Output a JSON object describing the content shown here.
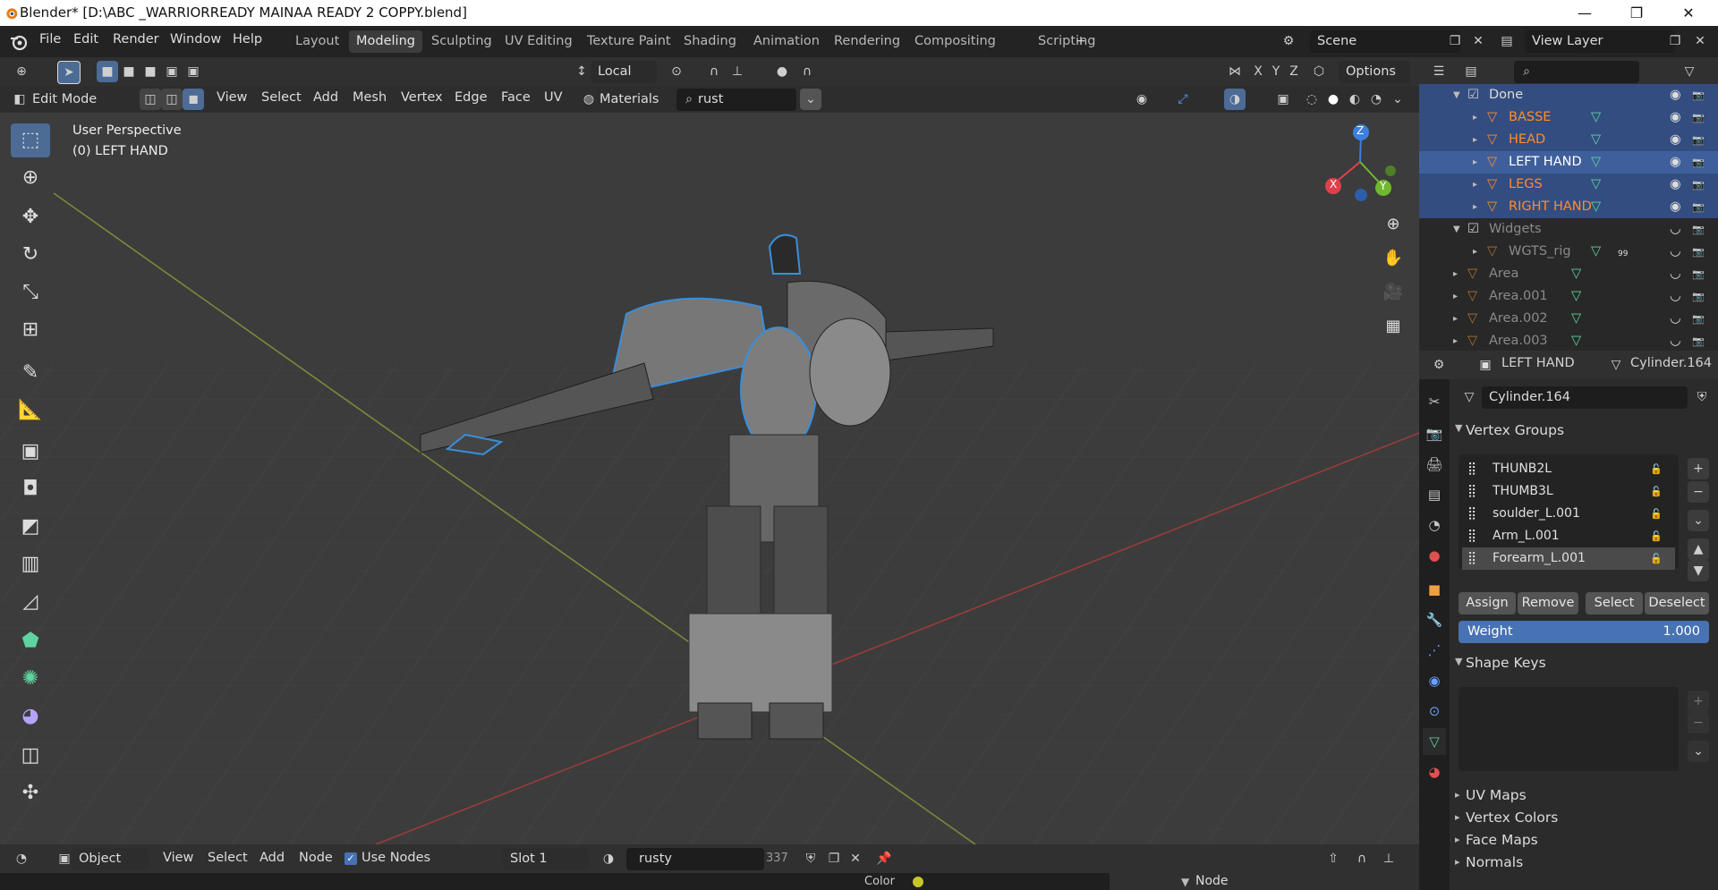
{
  "titlebar": {
    "title": "Blender* [D:\\ABC _WARRIORREADY MAINAA READY 2  COPPY.blend]",
    "minimize": "—",
    "maximize": "❐",
    "close": "✕"
  },
  "menus": [
    "File",
    "Edit",
    "Render",
    "Window",
    "Help"
  ],
  "workspaces": [
    "Layout",
    "Modeling",
    "Sculpting",
    "UV Editing",
    "Texture Paint",
    "Shading",
    "Animation",
    "Rendering",
    "Compositing",
    "Scripting"
  ],
  "active_workspace": "Modeling",
  "scene": {
    "label": "Scene"
  },
  "view_layer": {
    "label": "View Layer"
  },
  "tool_header": {
    "orientation": "Local",
    "options": "Options",
    "x": "X",
    "y": "Y",
    "z": "Z"
  },
  "viewport_header": {
    "mode": "Edit Mode",
    "menus": [
      "View",
      "Select",
      "Add",
      "Mesh",
      "Vertex",
      "Edge",
      "Face",
      "UV"
    ],
    "materials": "Materials",
    "search_value": "rust"
  },
  "viewport": {
    "perspective": "User Perspective",
    "object_label": "(0) LEFT HAND",
    "gizmo": {
      "x": "X",
      "y": "Y",
      "z": "Z"
    }
  },
  "outliner": {
    "rows": [
      {
        "name": "Done",
        "indent": 0,
        "collection": true,
        "selected": true
      },
      {
        "name": "BASSE",
        "indent": 1,
        "selected": true,
        "orange": true
      },
      {
        "name": "HEAD",
        "indent": 1,
        "selected": true,
        "orange": true
      },
      {
        "name": "LEFT HAND",
        "indent": 1,
        "selected": true,
        "active": true
      },
      {
        "name": "LEGS",
        "indent": 1,
        "selected": true,
        "orange": true
      },
      {
        "name": "RIGHT HAND",
        "indent": 1,
        "selected": true,
        "orange": true
      },
      {
        "name": "Widgets",
        "indent": 0,
        "collection": true,
        "dim": true
      },
      {
        "name": "WGTS_rig",
        "indent": 1,
        "dim": true,
        "badge": "99"
      },
      {
        "name": "Area",
        "indent": 0,
        "dim": true
      },
      {
        "name": "Area.001",
        "indent": 0,
        "dim": true
      },
      {
        "name": "Area.002",
        "indent": 0,
        "dim": true
      },
      {
        "name": "Area.003",
        "indent": 0,
        "dim": true
      }
    ]
  },
  "properties": {
    "object_name": "LEFT HAND",
    "mesh_name": "Cylinder.164",
    "data_field": "Cylinder.164",
    "vertex_groups_title": "Vertex Groups",
    "vertex_groups": [
      "THUNB2L",
      "THUMB3L",
      "soulder_L.001",
      "Arm_L.001",
      "Forearm_L.001"
    ],
    "active_group": "Forearm_L.001",
    "buttons": {
      "assign": "Assign",
      "remove": "Remove",
      "select": "Select",
      "deselect": "Deselect"
    },
    "weight": {
      "label": "Weight",
      "value": "1.000"
    },
    "shape_keys_title": "Shape Keys",
    "collapsed_panels": [
      "UV Maps",
      "Vertex Colors",
      "Face Maps",
      "Normals"
    ]
  },
  "shader_header": {
    "object": "Object",
    "menus": [
      "View",
      "Select",
      "Add",
      "Node"
    ],
    "use_nodes": "Use Nodes",
    "slot": "Slot 1",
    "material": "rusty",
    "users": "337"
  },
  "node_area": {
    "color_label": "Color",
    "node_label": "Node"
  },
  "colors": {
    "accent_blue": "#4772b3",
    "selected_row": "#334d80",
    "orange_object": "#ff8c2e",
    "viewport_bg": "#3c3c3c"
  }
}
